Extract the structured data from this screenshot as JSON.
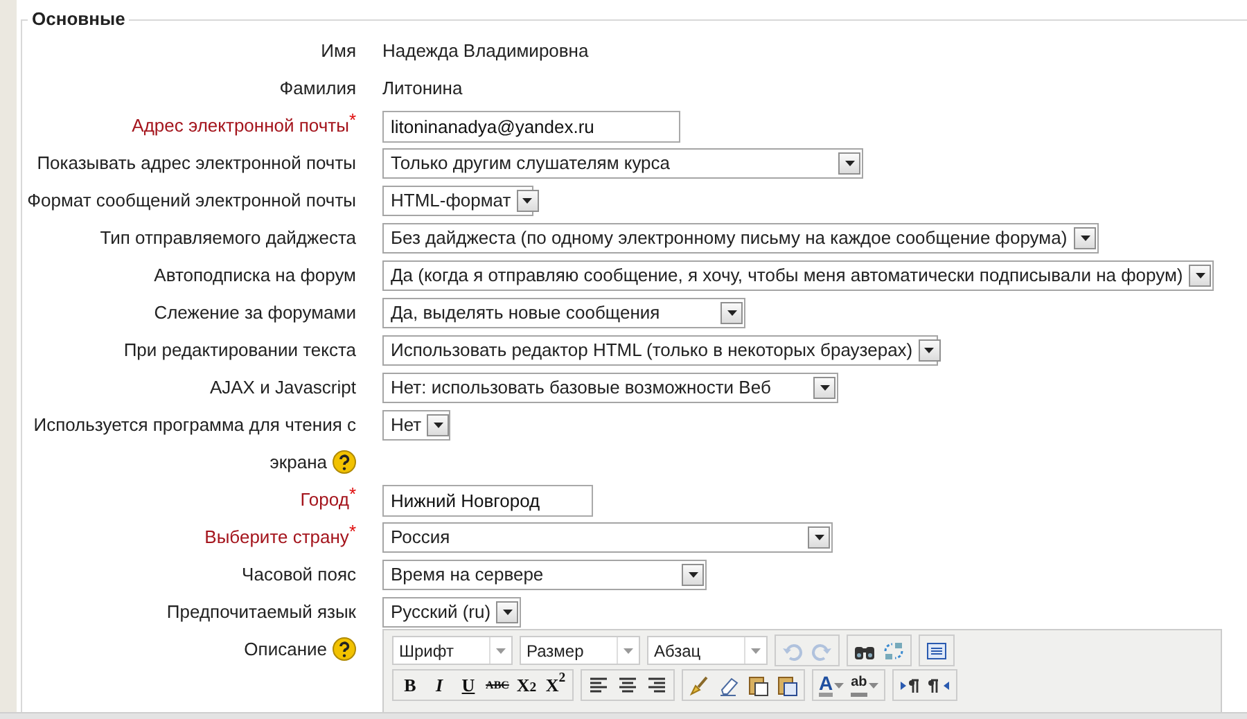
{
  "legend": "Основные",
  "fields": [
    {
      "kind": "static",
      "label": "Имя",
      "value": "Надежда Владимировна"
    },
    {
      "kind": "static",
      "label": "Фамилия",
      "value": "Литонина"
    },
    {
      "kind": "text",
      "label": "Адрес электронной почты",
      "required": true,
      "mark": "*",
      "value": "litoninanadya@yandex.ru"
    },
    {
      "kind": "select",
      "label": "Показывать адрес электронной почты",
      "value": "Только другим слушателям курса"
    },
    {
      "kind": "select",
      "label": "Формат сообщений электронной почты",
      "value": "HTML-формат"
    },
    {
      "kind": "select",
      "label": "Тип отправляемого дайджеста",
      "value": "Без дайджеста (по одному электронному письму на каждое сообщение форума)"
    },
    {
      "kind": "select",
      "label": "Автоподписка на форум",
      "value": "Да (когда я отправляю сообщение, я хочу, чтобы меня автоматически подписывали на форум)"
    },
    {
      "kind": "select",
      "label": "Слежение за форумами",
      "value": "Да, выделять новые сообщения"
    },
    {
      "kind": "select",
      "label": "При редактировании текста",
      "value": "Использовать редактор HTML (только в некоторых браузерах)"
    },
    {
      "kind": "select",
      "label": "AJAX и Javascript",
      "value": "Нет: использовать базовые возможности Веб"
    },
    {
      "kind": "select",
      "label": "Используется программа для чтения с",
      "label_2": "экрана",
      "help": true,
      "value": "Нет"
    },
    {
      "kind": "text",
      "label": "Город",
      "required": true,
      "mark": "*",
      "value": "Нижний Новгород"
    },
    {
      "kind": "select",
      "label": "Выберите страну",
      "required": true,
      "mark": "*",
      "value": "Россия"
    },
    {
      "kind": "select",
      "label": "Часовой пояс",
      "value": "Время на сервере"
    },
    {
      "kind": "select",
      "label": "Предпочитаемый язык",
      "value": "Русский (ru)"
    },
    {
      "kind": "editor",
      "label": "Описание",
      "help": true
    }
  ],
  "editor": {
    "dropdowns": [
      "Шрифт",
      "Размер",
      "Абзац"
    ],
    "history": [
      {
        "disabled": true
      },
      {
        "disabled": true
      }
    ],
    "text_buttons": [
      "B",
      "I",
      "U",
      "ABC",
      "X$_{2}$",
      "X$^{2}$"
    ],
    "color_buttons": [
      "A",
      "ab"
    ]
  }
}
